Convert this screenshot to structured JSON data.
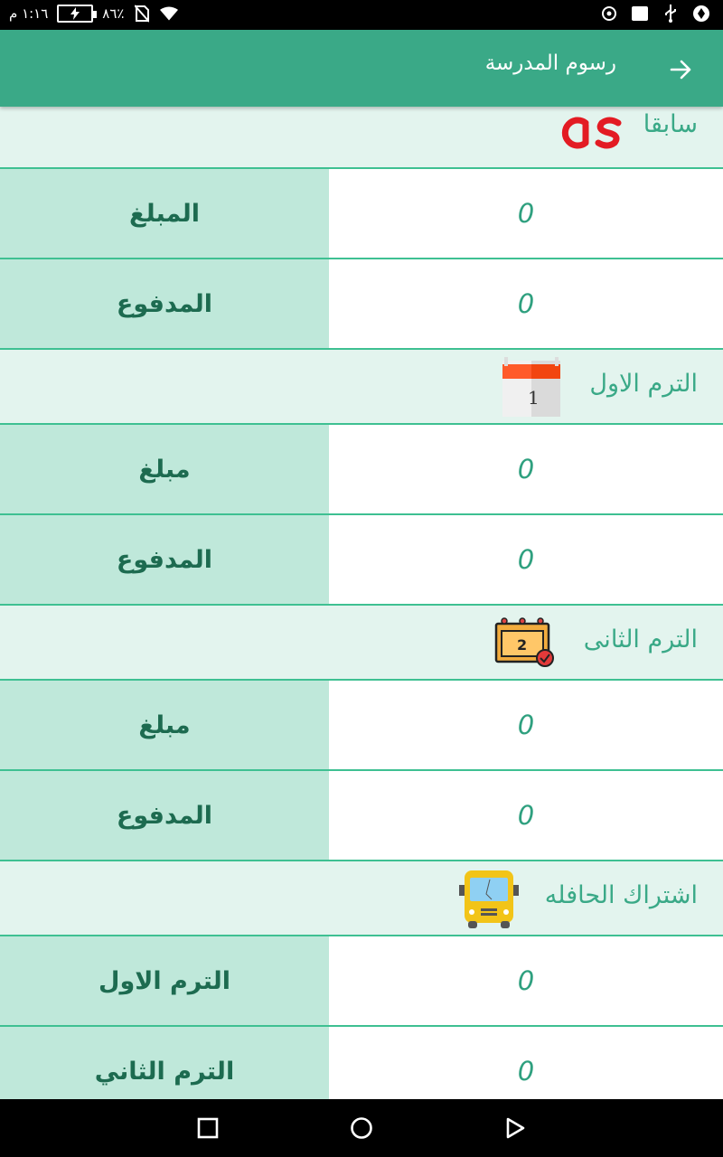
{
  "status_bar": {
    "time": "١:١٦ م",
    "battery": "٨٦٪"
  },
  "app_bar": {
    "title": "رسوم المدرسة",
    "back_icon": "arrow-right-icon"
  },
  "sections": [
    {
      "title": "سابقا",
      "icon": "lastfm-logo-icon",
      "rows": [
        {
          "label": "المبلغ",
          "value": "0"
        },
        {
          "label": "المدفوع",
          "value": "0"
        }
      ]
    },
    {
      "title": "الترم الاول",
      "icon": "calendar-1-icon",
      "icon_text": "1",
      "rows": [
        {
          "label": "مبلغ",
          "value": "0"
        },
        {
          "label": "المدفوع",
          "value": "0"
        }
      ]
    },
    {
      "title": "الترم الثانى",
      "icon": "calendar-2-icon",
      "icon_text": "2",
      "rows": [
        {
          "label": "مبلغ",
          "value": "0"
        },
        {
          "label": "المدفوع",
          "value": "0"
        }
      ]
    },
    {
      "title": "اشتراك الحافله",
      "icon": "bus-icon",
      "rows": [
        {
          "label": "الترم الاول",
          "value": "0"
        },
        {
          "label": "الترم الثاني",
          "value": "0"
        }
      ]
    }
  ],
  "colors": {
    "primary": "#3aa987",
    "section_bg": "#e3f4ee",
    "label_bg": "#bfe8da",
    "divider": "#3ec092",
    "label_text": "#1d6b50",
    "value_text": "#2fa07f"
  }
}
